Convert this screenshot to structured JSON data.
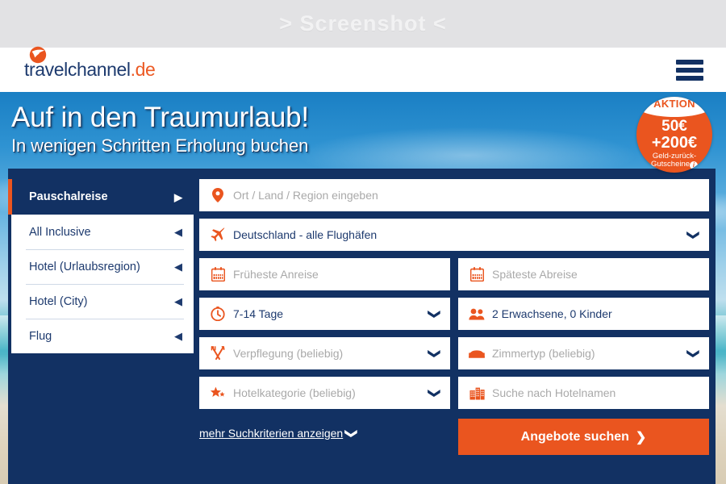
{
  "banner": {
    "text": "> Screenshot <"
  },
  "header": {
    "logo_name": "travelchannel",
    "logo_tld": ".de",
    "menu_icon": "hamburger-menu-icon"
  },
  "hero": {
    "title": "Auf in den Traumurlaub!",
    "subtitle": "In wenigen Schritten Erholung buchen"
  },
  "promo": {
    "ribbon": "AKTION",
    "amount_1": "50€",
    "amount_2": "+200€",
    "caption_line_1": "Geld-zurück-",
    "caption_line_2": "Gutscheine",
    "info_icon": "info-icon",
    "color": "#ea551f"
  },
  "tabs": [
    {
      "label": "Pauschalreise",
      "active": true,
      "arrow": "▶"
    },
    {
      "label": "All Inclusive",
      "active": false,
      "arrow": "◀"
    },
    {
      "label": "Hotel (Urlaubsregion)",
      "active": false,
      "arrow": "◀"
    },
    {
      "label": "Hotel (City)",
      "active": false,
      "arrow": "◀"
    },
    {
      "label": "Flug",
      "active": false,
      "arrow": "◀"
    }
  ],
  "fields": {
    "destination": {
      "placeholder": "Ort / Land / Region eingeben",
      "value": "",
      "icon": "location-pin-icon"
    },
    "airport": {
      "value": "Deutschland - alle Flughäfen",
      "icon": "airplane-icon",
      "chevron": "❯"
    },
    "earliest_arrival": {
      "placeholder": "Früheste Anreise",
      "value": "",
      "icon": "calendar-icon"
    },
    "latest_departure": {
      "placeholder": "Späteste Abreise",
      "value": "",
      "icon": "calendar-icon"
    },
    "duration": {
      "value": "7-14 Tage",
      "icon": "clock-icon",
      "chevron": "❯"
    },
    "travelers": {
      "value": "2 Erwachsene, 0 Kinder",
      "icon": "people-icon"
    },
    "board": {
      "placeholder": "Verpflegung (beliebig)",
      "value": "",
      "icon": "cutlery-icon",
      "chevron": "❯"
    },
    "room_type": {
      "placeholder": "Zimmertyp (beliebig)",
      "value": "",
      "icon": "bed-icon",
      "chevron": "❯"
    },
    "hotel_category": {
      "placeholder": "Hotelkategorie (beliebig)",
      "value": "",
      "icon": "star-icon",
      "chevron": "❯"
    },
    "hotel_name": {
      "placeholder": "Suche nach Hotelnamen",
      "value": "",
      "icon": "buildings-icon"
    }
  },
  "bottom": {
    "more_criteria": "mehr Suchkriterien anzeigen",
    "more_chevron": "❯",
    "submit": "Angebote suchen",
    "submit_arrow": "❯"
  },
  "colors": {
    "navy": "#123163",
    "orange": "#ea551f",
    "text_navy": "#1d3a6e",
    "placeholder_gray": "#a9a9a9"
  }
}
